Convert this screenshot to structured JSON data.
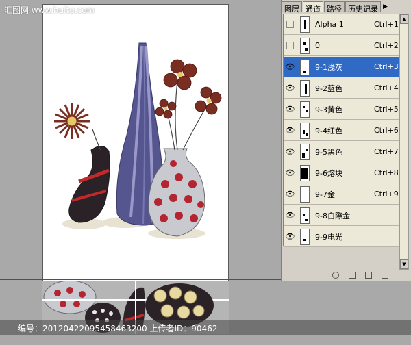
{
  "watermark": {
    "site": "汇图网 www.huitu.com"
  },
  "footer": {
    "text": "编号：20120422095458463200 上传者ID：90462"
  },
  "panel": {
    "tabs": [
      "图层",
      "通道",
      "路径",
      "历史记录"
    ],
    "active_tab": "通道",
    "channels": [
      {
        "label": "Alpha 1",
        "shortcut": "Ctrl+1",
        "visible": false,
        "selected": false
      },
      {
        "label": "0",
        "shortcut": "Ctrl+2",
        "visible": false,
        "selected": false
      },
      {
        "label": "9-1浅灰",
        "shortcut": "Ctrl+3",
        "visible": true,
        "selected": true
      },
      {
        "label": "9-2蓝色",
        "shortcut": "Ctrl+4",
        "visible": true,
        "selected": false
      },
      {
        "label": "9-3黄色",
        "shortcut": "Ctrl+5",
        "visible": true,
        "selected": false
      },
      {
        "label": "9-4红色",
        "shortcut": "Ctrl+6",
        "visible": true,
        "selected": false
      },
      {
        "label": "9-5黑色",
        "shortcut": "Ctrl+7",
        "visible": true,
        "selected": false
      },
      {
        "label": "9-6熔块",
        "shortcut": "Ctrl+8",
        "visible": true,
        "selected": false
      },
      {
        "label": "9-7金",
        "shortcut": "Ctrl+9",
        "visible": true,
        "selected": false
      },
      {
        "label": "9-8白際金",
        "shortcut": "",
        "visible": true,
        "selected": false
      },
      {
        "label": "9-9电光",
        "shortcut": "",
        "visible": true,
        "selected": false
      }
    ]
  },
  "colors": {
    "selection": "#316ac5",
    "vase_blue": "#5a5a9a",
    "vase_red": "#b3262e",
    "flower": "#7a2e22"
  }
}
